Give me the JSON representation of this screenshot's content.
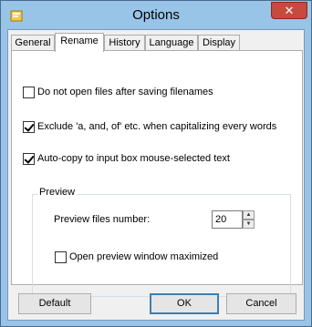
{
  "window": {
    "title": "Options",
    "close_label": "✕"
  },
  "tabs": [
    {
      "label": "General"
    },
    {
      "label": "Rename"
    },
    {
      "label": "History"
    },
    {
      "label": "Language"
    },
    {
      "label": "Display"
    }
  ],
  "rename": {
    "option1": {
      "label": "Do not open files after saving filenames",
      "checked": false
    },
    "option2": {
      "label": "Exclude 'a, and, of' etc. when capitalizing every words",
      "checked": true
    },
    "option3": {
      "label": "Auto-copy to input box mouse-selected text",
      "checked": true
    }
  },
  "preview": {
    "group_title": "Preview",
    "files_number_label": "Preview files number:",
    "files_number_value": "20",
    "maximized_label": "Open preview window maximized",
    "maximized_checked": false
  },
  "buttons": {
    "default": "Default",
    "ok": "OK",
    "cancel": "Cancel"
  },
  "icons": {
    "app": "app-icon",
    "close": "close-icon",
    "spin_up": "spin-up-icon",
    "spin_down": "spin-down-icon"
  }
}
